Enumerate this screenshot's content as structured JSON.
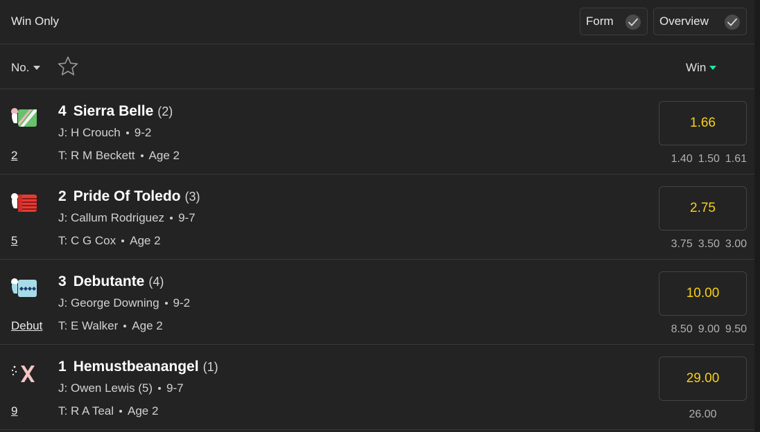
{
  "market": {
    "title": "Win Only"
  },
  "toggles": {
    "form_label": "Form",
    "overview_label": "Overview"
  },
  "header": {
    "number_label": "No.",
    "win_label": "Win"
  },
  "colors": {
    "odds": "#f7d117",
    "sort_accent": "#1ee7a7"
  },
  "runners": [
    {
      "number": "4",
      "name": "Sierra Belle",
      "draw": "(2)",
      "jockey": "J: H Crouch",
      "weight": "9-2",
      "trainer": "T: R M Beckett",
      "age": "Age 2",
      "form": "2",
      "odds": "1.66",
      "history": [
        "1.40",
        "1.50",
        "1.61"
      ],
      "silk_icon": "green-white-diagonal-silk-icon"
    },
    {
      "number": "2",
      "name": "Pride Of Toledo",
      "draw": "(3)",
      "jockey": "J: Callum Rodriguez",
      "weight": "9-7",
      "trainer": "T: C G Cox",
      "age": "Age 2",
      "form": "5",
      "odds": "2.75",
      "history": [
        "3.75",
        "3.50",
        "3.00"
      ],
      "silk_icon": "red-hooped-silk-icon"
    },
    {
      "number": "3",
      "name": "Debutante",
      "draw": "(4)",
      "jockey": "J: George Downing",
      "weight": "9-2",
      "trainer": "T: E Walker",
      "age": "Age 2",
      "form": "Debut",
      "odds": "10.00",
      "history": [
        "8.50",
        "9.00",
        "9.50"
      ],
      "silk_icon": "light-blue-diamonds-silk-icon"
    },
    {
      "number": "1",
      "name": "Hemustbeanangel",
      "draw": "(1)",
      "jockey": "J: Owen Lewis (5)",
      "weight": "9-7",
      "trainer": "T: R A Teal",
      "age": "Age 2",
      "form": "9",
      "odds": "29.00",
      "history": [
        "26.00"
      ],
      "silk_icon": "pink-cross-belts-silk-icon"
    }
  ]
}
